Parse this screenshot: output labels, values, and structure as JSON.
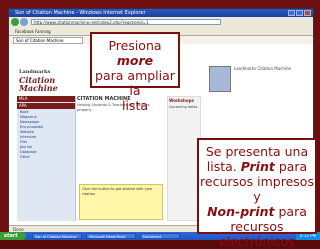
{
  "browser": {
    "title": "Son of Citation Machine - Windows Internet Explorer",
    "address": "http://www.citationmachine.net/index2.php?reqstyleid=1",
    "tab_label": "Son of Citation Machine",
    "status": "Done",
    "toolbar_text": "Facebook Fanning"
  },
  "site": {
    "logo_line1": "Landmarks",
    "logo_line2": "Citation",
    "logo_line3": "Machine",
    "side_band1": "MLA",
    "side_band2": "APA",
    "side_items": [
      "Book",
      "Magazine",
      "Newspaper",
      "Encyclopedia",
      "Website",
      "Interview",
      "Film",
      "Journal",
      "Database",
      "Other"
    ],
    "content_heading": "CITATION MACHINE",
    "content_text": "Helping Students & Teachers cite sources properly",
    "yellow_text": "Click the button to get started with your citation",
    "right_heading": "Workshops",
    "right_text": "Upcoming dates",
    "top_right_text": "Landmarks Citation Machine"
  },
  "taskbar": {
    "start_label": "start",
    "items": [
      "Son of Citation Machine",
      "Microsoft PowerPoint",
      "Document"
    ],
    "clock": "4:12 PM"
  },
  "callouts": {
    "c1_prefix": "Presiona",
    "c1_bold": "more",
    "c1_suffix1": "para ampliar la",
    "c1_suffix2": "lista",
    "c2_line1": "Se presenta una",
    "c2_line2a": "lista.",
    "c2_bold1": "Print",
    "c2_line2b": "para",
    "c2_line3": "recursos impresos y",
    "c2_bold2": "Non-print",
    "c2_line4b": "para",
    "c2_line5": "recursos",
    "c2_line6": "electrónicos"
  }
}
